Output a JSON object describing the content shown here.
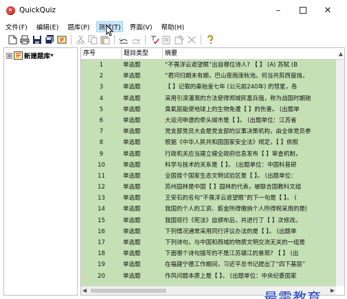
{
  "window": {
    "title": "QuickQuiz",
    "controls": {
      "minimize": "–",
      "close": "✕"
    }
  },
  "menu": [
    "文件(F)",
    "编辑(E)",
    "题库(P)",
    "测试(T)",
    "界面(V)",
    "帮助(H)"
  ],
  "menu_active_index": 3,
  "toolbar": {
    "icons": [
      "new-icon",
      "print-icon",
      "save-icon",
      "save-all-icon",
      "bank-icon",
      "cut-icon",
      "copy-icon",
      "paste-icon",
      "undo-icon",
      "redo-icon",
      "spell-check-icon",
      "edit-icon",
      "properties-icon",
      "delete-icon",
      "help-icon"
    ]
  },
  "tree": {
    "expander": "⊞",
    "root_label": "新建题库*"
  },
  "table": {
    "headers": {
      "seq": "序号",
      "type": "题目类型",
      "summary": "摘要"
    },
    "rows": [
      {
        "seq": "1",
        "type": "单选题",
        "summary": "“不畏浮云遮望眼”出自哪位诗人? 【    】 (A) 苏轼 (B"
      },
      {
        "seq": "2",
        "type": "单选题",
        "summary": "“君问归期未有期，巴山夜雨涨秋池。何当共剪西窗烛，"
      },
      {
        "seq": "3",
        "type": "单选题",
        "summary": "【    】记载的秦始皇七年 (公元前240年) 的彗星，各"
      },
      {
        "seq": "4",
        "type": "单选题",
        "summary": "采用引滦灌溉的方法使得郑城民富兵强，称为战国时期驰"
      },
      {
        "seq": "5",
        "type": "单选题",
        "summary": "臭氧层能使地球上的生物免遭【    】的伤害。 (出题单"
      },
      {
        "seq": "6",
        "type": "单选题",
        "summary": "大运河申遗的牵头城市是【    】。 (出题单位：江苏省"
      },
      {
        "seq": "7",
        "type": "单选题",
        "summary": "党支部党员大会是党支部的议事决策机构，由全体党员参"
      },
      {
        "seq": "8",
        "type": "单选题",
        "summary": "根据《中华人民共和国国家安全法》规定，【    】依照"
      },
      {
        "seq": "9",
        "type": "单选题",
        "summary": "行政机关应当建立健全政府信息发布【    】审查机制，"
      },
      {
        "seq": "10",
        "type": "单选题",
        "summary": "科学与技术的关系是【    】。 (出题单位：中国科普研"
      },
      {
        "seq": "11",
        "type": "单选题",
        "summary": "全国首个国家生态文明试验区是【    】。 (出题单位："
      },
      {
        "seq": "12",
        "type": "单选题",
        "summary": "苏州园林是中国【    】园林的代表，被联合国教科文组"
      },
      {
        "seq": "13",
        "type": "单选题",
        "summary": "王安石的名句“不畏浮云遮望眼”的下一句是【    】。 ("
      },
      {
        "seq": "14",
        "type": "单选题",
        "summary": "我国的个人的工资、薪金所得缴纳个人所得税采用的是("
      },
      {
        "seq": "15",
        "type": "单选题",
        "summary": "我国现行《宪法》自颁布后，共进行了【    】次修改。"
      },
      {
        "seq": "16",
        "type": "单选题",
        "summary": "下列情况通常采用同行评议办法的是【    】。 (出题单"
      },
      {
        "seq": "17",
        "type": "单选题",
        "summary": "下列诗句，与中国和西域的物质文明交流无关的一组是"
      },
      {
        "seq": "18",
        "type": "单选题",
        "summary": "下面哪个诗句描写的不是江苏镇江的景观? 【    】 (出"
      },
      {
        "seq": "19",
        "type": "单选题",
        "summary": "在福建宁德工作期间，习近平总书记提出了“四下基层”"
      },
      {
        "seq": "20",
        "type": "单选题",
        "summary": "作风问题本质上是【    】。 (出题单位：中央纪委国家"
      }
    ]
  },
  "watermark": "最需教育",
  "colors": {
    "row_fill": "#c4e0b4",
    "menu_highlight": "#cde8ff",
    "watermark": "#1d3fbb"
  }
}
